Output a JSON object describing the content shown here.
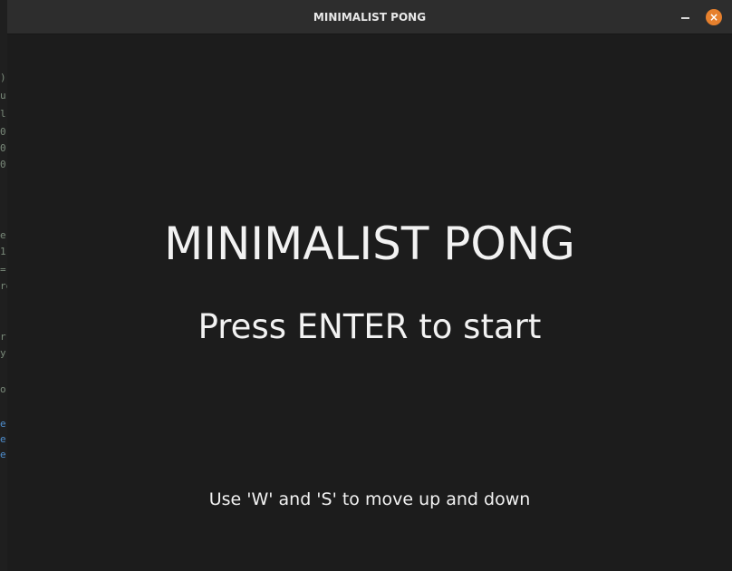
{
  "window": {
    "title": "MINIMALIST PONG",
    "close_glyph": "×",
    "icons": {
      "minimize": "minimize-icon",
      "close": "close-icon"
    },
    "colors": {
      "titlebar": "#2d2d2d",
      "close_button": "#e6802d",
      "game_background": "#1c1c1c",
      "game_text": "#f2f2f2"
    }
  },
  "game": {
    "title": "MINIMALIST PONG",
    "start_prompt": "Press ENTER to start",
    "controls_hint": "Use 'W' and 'S' to move up and down"
  },
  "background_editor": {
    "fragments": [
      ")",
      "u",
      "l",
      "0",
      "0",
      "0",
      "e",
      "1",
      "=",
      "re",
      "r",
      "y",
      "o",
      "e",
      "e",
      "e"
    ]
  }
}
